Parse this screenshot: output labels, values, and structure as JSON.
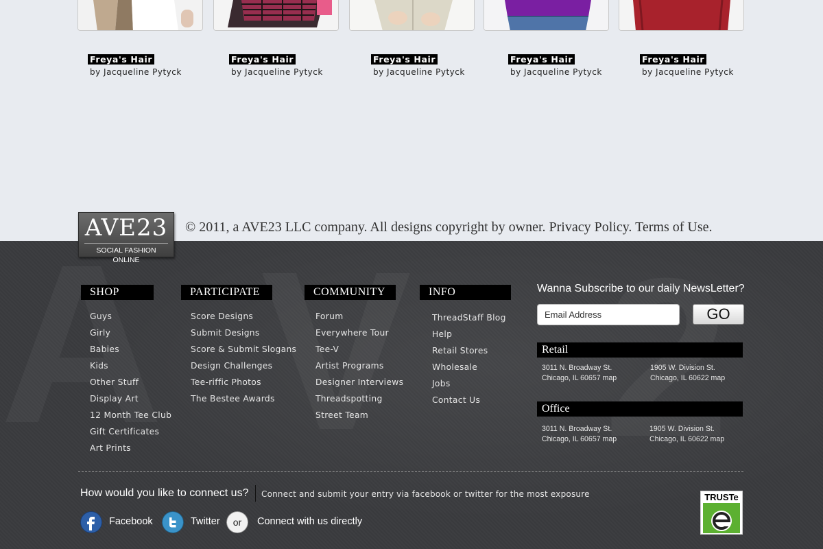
{
  "products": [
    {
      "title": "Freya's Hair",
      "author": "by Jacqueline Pytyck"
    },
    {
      "title": "Freya's Hair",
      "author": "by Jacqueline Pytyck"
    },
    {
      "title": "Freya's Hair",
      "author": "by Jacqueline Pytyck"
    },
    {
      "title": "Freya's Hair",
      "author": "by Jacqueline Pytyck"
    },
    {
      "title": "Freya's Hair",
      "author": "by Jacqueline Pytyck"
    }
  ],
  "logo": {
    "big": "AVE23",
    "small": "SOCIAL FASHION ONLINE"
  },
  "copyright": "© 2011, a AVE23 LLC company. All designs copyright by owner. Privacy Policy. Terms of Use.",
  "shop": {
    "title": "SHOP",
    "items": [
      "Guys",
      "Girly",
      "Babies",
      "Kids",
      "Other Stuff",
      "Display Art",
      "12 Month Tee Club",
      "Gift Certificates",
      "Art Prints"
    ]
  },
  "participate": {
    "title": "PARTICIPATE",
    "items": [
      "Score Designs",
      "Submit Designs",
      "Score & Submit Slogans",
      "Design Challenges",
      "Tee-riffic Photos",
      "The Bestee Awards"
    ]
  },
  "community": {
    "title": "COMMUNITY",
    "items": [
      "Forum",
      "Everywhere Tour",
      "Tee-V",
      "Artist Programs",
      "Designer Interviews",
      "Threadspotting",
      "Street Team"
    ]
  },
  "info": {
    "title": "INFO",
    "items": [
      "ThreadStaff Blog",
      "Help",
      "Retail Stores",
      "Wholesale",
      "Jobs",
      "Contact Us"
    ]
  },
  "newsletter": {
    "title": "Wanna Subscribe to our daily NewsLetter?",
    "email_value": "Email Address",
    "go_label": "GO"
  },
  "retail": {
    "title": "Retail",
    "addr1_line1": "3011 N. Broadway St.",
    "addr1_line2": "Chicago, IL 60657 map",
    "addr2_line1": "1905 W. Division St.",
    "addr2_line2": "Chicago, IL 60622 map"
  },
  "office": {
    "title": "Office",
    "addr1_line1": "3011 N. Broadway St.",
    "addr1_line2": "Chicago, IL 60657 map",
    "addr2_line1": "1905 W. Division St.",
    "addr2_line2": "Chicago, IL 60622 map"
  },
  "connect": {
    "question": "How would you like to connect us?",
    "description": "Connect and submit your entry via facebook or twitter for the most exposure",
    "facebook": "Facebook",
    "twitter": "Twitter",
    "or": "or",
    "direct": "Connect with us directly"
  },
  "truste": "TRUSTe",
  "colors": {
    "page_bg": "#e8ebf0",
    "footer_bg": "#3a3b3e",
    "facebook": "#2d5fa8",
    "twitter": "#3a93c9",
    "truste_green": "#5cb031"
  }
}
